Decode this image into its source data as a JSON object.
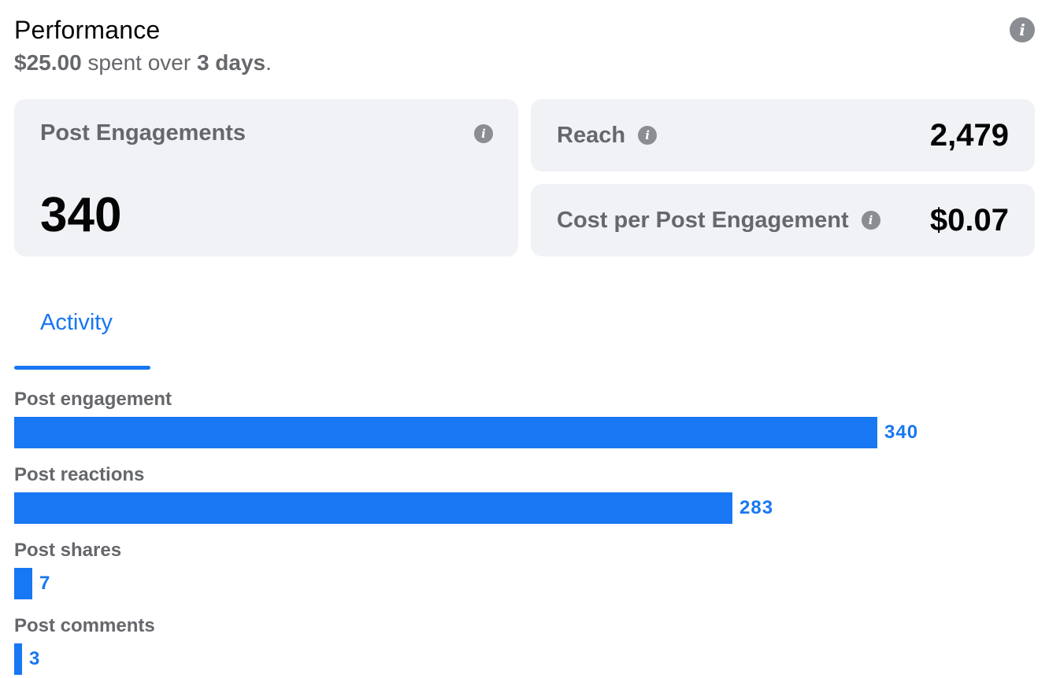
{
  "header": {
    "title": "Performance",
    "spend_amount": "$25.00",
    "spend_middle": "spent over",
    "days": "3 days",
    "period_char": "."
  },
  "cards": {
    "post_engagements": {
      "label": "Post Engagements",
      "value": "340"
    },
    "reach": {
      "label": "Reach",
      "value": "2,479"
    },
    "cost_per_engagement": {
      "label": "Cost per Post Engagement",
      "value": "$0.07"
    }
  },
  "tabs": [
    {
      "label": "Activity",
      "active": true
    }
  ],
  "activity_bars": {
    "max_value": 340,
    "items": [
      {
        "label": "Post engagement",
        "value": 340,
        "display": "340"
      },
      {
        "label": "Post reactions",
        "value": 283,
        "display": "283"
      },
      {
        "label": "Post shares",
        "value": 7,
        "display": "7"
      },
      {
        "label": "Post comments",
        "value": 3,
        "display": "3"
      }
    ]
  },
  "icons": {
    "info": "info-icon"
  },
  "colors": {
    "accent": "#1877f2",
    "card_bg": "#f0f2f5",
    "muted_text": "#65676b",
    "icon_gray": "#8a8d91"
  }
}
